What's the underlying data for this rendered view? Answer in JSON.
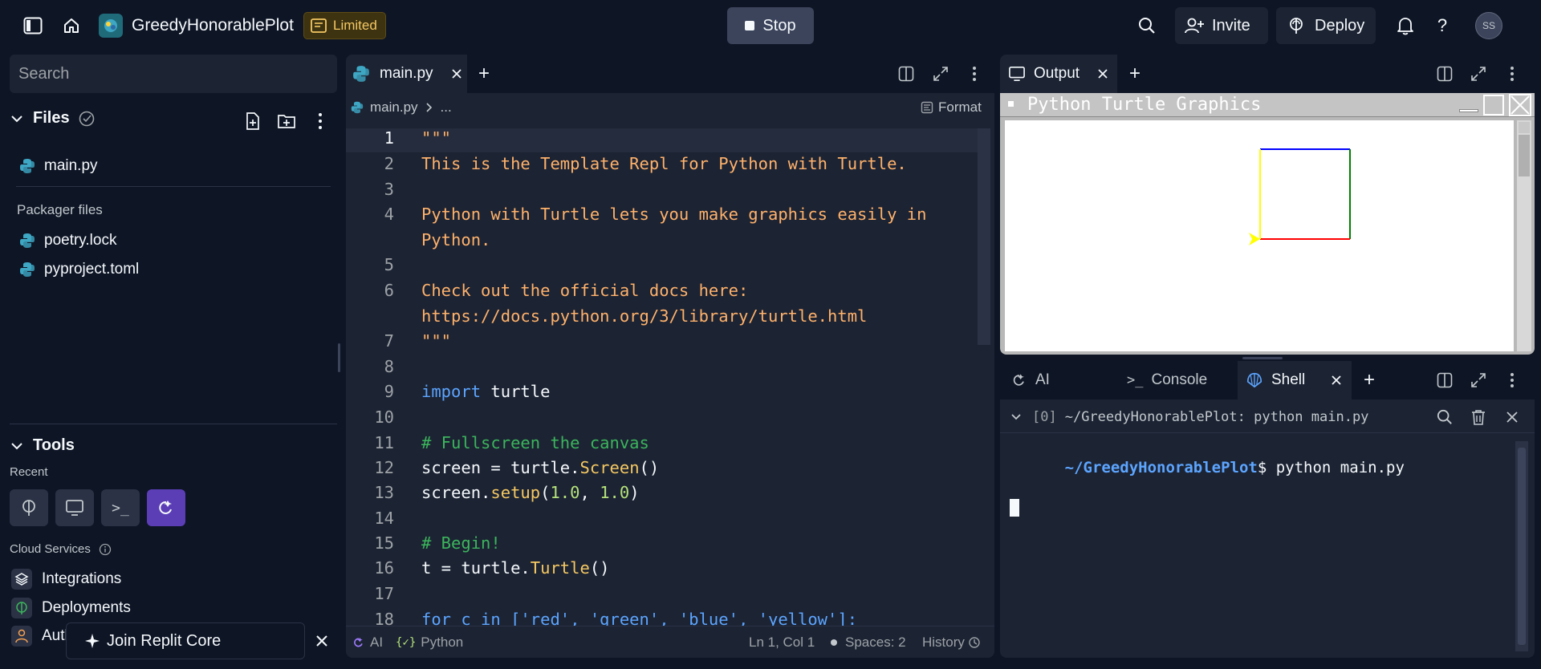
{
  "topbar": {
    "repl_name": "GreedyHonorablePlot",
    "limited_label": "Limited",
    "stop_label": "Stop",
    "invite_label": "Invite",
    "deploy_label": "Deploy",
    "avatar_initials": "SS"
  },
  "sidebar": {
    "search_placeholder": "Search",
    "files_heading": "Files",
    "files": [
      {
        "name": "main.py"
      }
    ],
    "packager_heading": "Packager files",
    "packager_files": [
      {
        "name": "poetry.lock"
      },
      {
        "name": "pyproject.toml"
      }
    ],
    "tools_heading": "Tools",
    "recent_label": "Recent",
    "cloud_label": "Cloud Services",
    "cloud_items": [
      {
        "name": "Integrations"
      },
      {
        "name": "Deployments"
      },
      {
        "name": "Authentication"
      }
    ],
    "join_label": "Join Replit Core"
  },
  "editor": {
    "tab_label": "main.py",
    "breadcrumb_file": "main.py",
    "breadcrumb_more": "...",
    "format_label": "Format",
    "lines": {
      "l1": "\"\"\"",
      "l2": "This is the Template Repl for Python with Turtle.",
      "l4a": "Python with Turtle lets you make graphics easily in",
      "l4b": "Python.",
      "l6a": "Check out the official docs here:",
      "l6b": "https://docs.python.org/3/library/turtle.html",
      "l7": "\"\"\"",
      "l9_kw": "import",
      "l9_rest": " turtle",
      "l11": "# Fullscreen the canvas",
      "l12_a": "screen = turtle.",
      "l12_fn": "Screen",
      "l12_b": "()",
      "l13_a": "screen.",
      "l13_fn": "setup",
      "l13_b": "(",
      "l13_n1": "1.0",
      "l13_c": ", ",
      "l13_n2": "1.0",
      "l13_d": ")",
      "l15": "# Begin!",
      "l16_a": "t = turtle.",
      "l16_fn": "Turtle",
      "l16_b": "()",
      "l18": "for c in ['red', 'green', 'blue', 'yellow']:"
    },
    "line_numbers": [
      "1",
      "2",
      "3",
      "4",
      "5",
      "6",
      "7",
      "8",
      "9",
      "10",
      "11",
      "12",
      "13",
      "14",
      "15",
      "16",
      "17",
      "18"
    ],
    "status": {
      "ai": "AI",
      "language": "Python",
      "position": "Ln 1, Col 1",
      "spaces": "Spaces: 2",
      "history": "History"
    }
  },
  "output": {
    "tab_label": "Output",
    "window_title": "Python Turtle Graphics",
    "square_colors": {
      "top": "#0000ff",
      "right": "#008000",
      "bottom": "#ff0000",
      "left": "#ffff00"
    }
  },
  "bottom": {
    "tabs": [
      {
        "label": "AI"
      },
      {
        "label": "Console"
      },
      {
        "label": "Shell"
      }
    ],
    "shell_header": "~/GreedyHonorablePlot: python main.py",
    "shell_index": "[0]",
    "prompt_path": "~/GreedyHonorablePlot",
    "prompt_cmd": "$ python main.py"
  }
}
